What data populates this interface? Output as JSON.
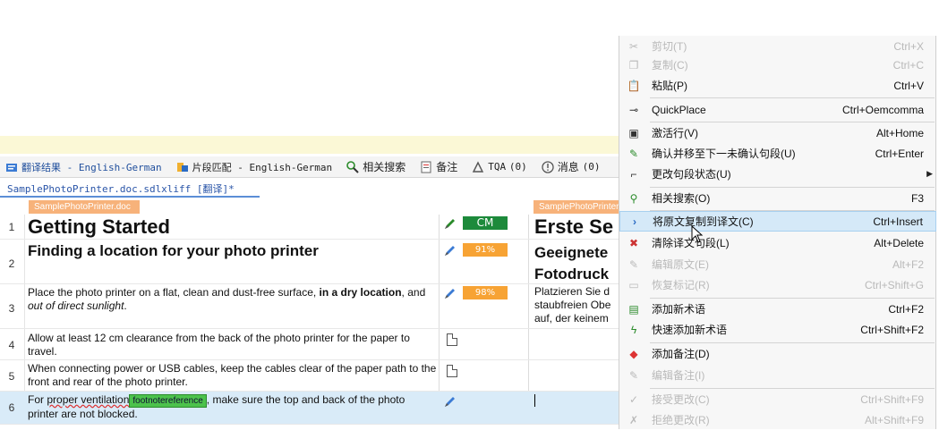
{
  "tabs": [
    {
      "label": "翻译结果 - English-German",
      "icon": "translation-results-icon"
    },
    {
      "label": "片段匹配 - English-German",
      "icon": "fragment-match-icon"
    },
    {
      "label": "相关搜索",
      "icon": "concordance-search-icon"
    },
    {
      "label": "备注",
      "icon": "comments-icon"
    },
    {
      "label": "TQA",
      "count": "(0)",
      "icon": "tqa-icon"
    },
    {
      "label": "消息",
      "count": "(0)",
      "icon": "messages-icon"
    }
  ],
  "file_tab": "SamplePhotoPrinter.doc.sdlxliff [翻译]*",
  "source_doc_flag": "SamplePhotoPrinter.doc",
  "target_doc_flag": "SamplePhotoPrinter.doc",
  "segments": [
    {
      "num": "1",
      "source": "Getting Started",
      "status": "CM",
      "target": "Erste Se"
    },
    {
      "num": "2",
      "source": "Finding a location for your photo printer",
      "status": "91%",
      "target_line1": "Geeignete",
      "target_line2": "Fotodruck"
    },
    {
      "num": "3",
      "source_a": "Place the photo printer on a flat, clean and dust-free surface, ",
      "source_b": "in a dry location",
      "source_c": ", and ",
      "source_d": "out of direct sunlight",
      "source_e": ".",
      "status": "98%",
      "target_line1": "Platzieren Sie d",
      "target_line2": "staubfreien Obe",
      "target_line3": "auf, der keinem"
    },
    {
      "num": "4",
      "source": "Allow at least 12 cm clearance from the back of the photo printer for the paper to travel."
    },
    {
      "num": "5",
      "source": "When connecting power or USB cables, keep the cables clear of the paper path to the front and rear of the photo printer."
    },
    {
      "num": "6",
      "source_a": "For ",
      "source_b": "proper ventilation",
      "tag": "footnotereference",
      "source_c": ", make sure the top and back of the photo printer are not blocked."
    }
  ],
  "context_menu": {
    "items": [
      {
        "label": "剪切(T)",
        "shortcut": "Ctrl+X",
        "disabled": true,
        "icon": "scissors-icon"
      },
      {
        "label": "复制(C)",
        "shortcut": "Ctrl+C",
        "disabled": true,
        "icon": "copy-icon"
      },
      {
        "label": "粘贴(P)",
        "shortcut": "Ctrl+V",
        "disabled": false,
        "icon": "paste-icon"
      },
      {
        "label": "QuickPlace",
        "shortcut": "Ctrl+Oemcomma",
        "disabled": false,
        "icon": "quickplace-icon"
      },
      {
        "label": "激活行(V)",
        "shortcut": "Alt+Home",
        "disabled": false,
        "icon": "activate-row-icon"
      },
      {
        "label": "确认并移至下一未确认句段(U)",
        "shortcut": "Ctrl+Enter",
        "disabled": false,
        "icon": "confirm-icon"
      },
      {
        "label": "更改句段状态(U)",
        "shortcut": "",
        "disabled": false,
        "icon": "change-status-icon",
        "submenu": true
      },
      {
        "label": "相关搜索(O)",
        "shortcut": "F3",
        "disabled": false,
        "icon": "concordance-icon"
      },
      {
        "label": "将原文复制到译文(C)",
        "shortcut": "Ctrl+Insert",
        "disabled": false,
        "highlighted": true,
        "icon": "copy-source-icon"
      },
      {
        "label": "清除译文句段(L)",
        "shortcut": "Alt+Delete",
        "disabled": false,
        "icon": "clear-target-icon"
      },
      {
        "label": "编辑原文(E)",
        "shortcut": "Alt+F2",
        "disabled": true,
        "icon": "edit-source-icon"
      },
      {
        "label": "恢复标记(R)",
        "shortcut": "Ctrl+Shift+G",
        "disabled": true,
        "icon": "restore-tags-icon"
      },
      {
        "label": "添加新术语",
        "shortcut": "Ctrl+F2",
        "disabled": false,
        "icon": "add-term-icon"
      },
      {
        "label": "快速添加新术语",
        "shortcut": "Ctrl+Shift+F2",
        "disabled": false,
        "icon": "quick-add-term-icon"
      },
      {
        "label": "添加备注(D)",
        "shortcut": "",
        "disabled": false,
        "icon": "add-comment-icon"
      },
      {
        "label": "编辑备注(I)",
        "shortcut": "",
        "disabled": true,
        "icon": "edit-comment-icon"
      },
      {
        "label": "接受更改(C)",
        "shortcut": "Ctrl+Shift+F9",
        "disabled": true,
        "icon": "accept-change-icon"
      },
      {
        "label": "拒绝更改(R)",
        "shortcut": "Alt+Shift+F9",
        "disabled": true,
        "icon": "reject-change-icon"
      }
    ]
  },
  "colors": {
    "cm_badge": "#1d8a3b",
    "fuzzy_badge": "#f7a334",
    "menu_highlight": "#d5e9f8",
    "doc_flag": "#f7b27a"
  }
}
